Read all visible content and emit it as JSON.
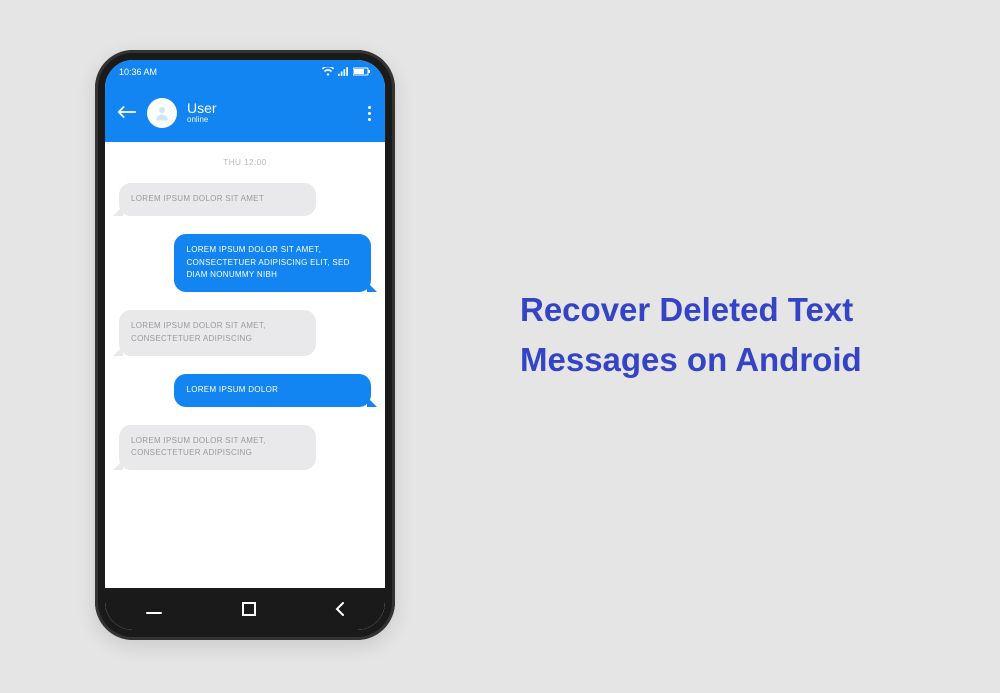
{
  "headline": "Recover Deleted Text Messages on Android",
  "phone": {
    "status": {
      "time": "10:36 AM"
    },
    "header": {
      "user_name": "User",
      "user_status": "online"
    },
    "date_separator": "THU 12:00",
    "messages": [
      {
        "dir": "in",
        "text": "LOREM IPSUM DOLOR SIT AMET"
      },
      {
        "dir": "out",
        "text": "LOREM IPSUM DOLOR SIT AMET, CONSECTETUER ADIPISCING ELIT, SED DIAM NONUMMY NIBH"
      },
      {
        "dir": "in",
        "text": "LOREM IPSUM DOLOR SIT AMET, CONSECTETUER ADIPISCING"
      },
      {
        "dir": "out",
        "text": "LOREM IPSUM DOLOR"
      },
      {
        "dir": "in",
        "text": "LOREM IPSUM DOLOR SIT AMET, CONSECTETUER ADIPISCING"
      }
    ]
  }
}
